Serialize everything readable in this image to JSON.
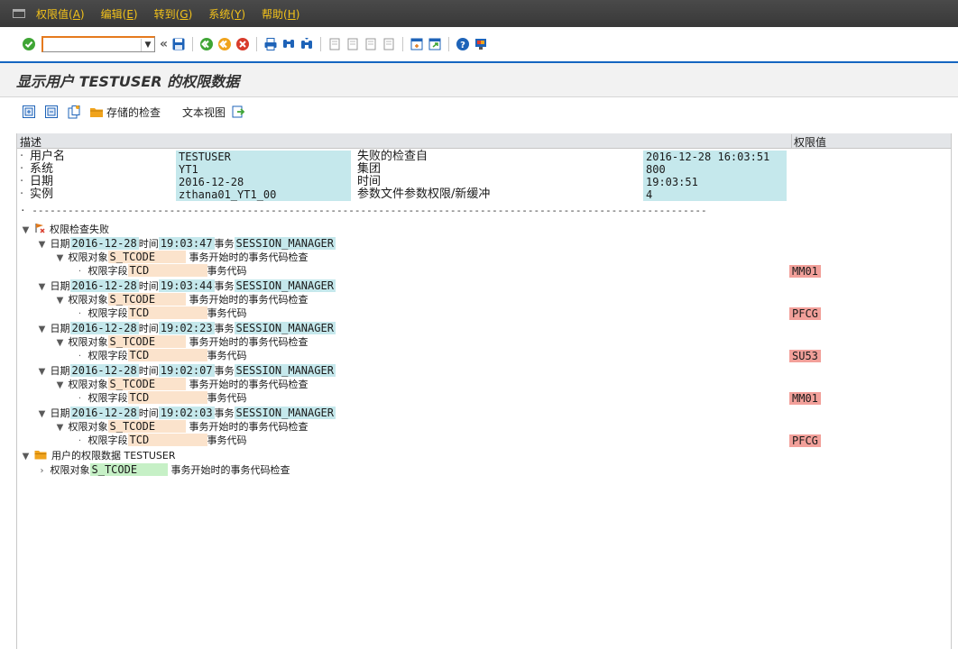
{
  "menu": {
    "items": [
      {
        "text": "权限值",
        "key": "A"
      },
      {
        "text": "编辑",
        "key": "E"
      },
      {
        "text": "转到",
        "key": "G"
      },
      {
        "text": "系统",
        "key": "Y"
      },
      {
        "text": "帮助",
        "key": "H"
      }
    ]
  },
  "toolbar": {
    "command_value": "",
    "icons": [
      "check-icon",
      "save-icon",
      "back-icon",
      "exit-icon",
      "cancel-icon",
      "print-icon",
      "find-icon",
      "find-next-icon",
      "first-page-icon",
      "prev-page-icon",
      "next-page-icon",
      "last-page-icon",
      "new-session-icon",
      "shortcut-icon",
      "help-icon",
      "customize-icon"
    ]
  },
  "title": "显示用户 TESTUSER 的权限数据",
  "app_toolbar": {
    "stored_checks_label": "存储的检查",
    "text_view_label": "文本视图"
  },
  "list": {
    "col_desc": "描述",
    "col_auth": "权限值",
    "header_rows": [
      {
        "label": "用户名",
        "value": "TESTUSER",
        "label2": "失败的检查自",
        "value2": "2016-12-28 16:03:51"
      },
      {
        "label": "系统",
        "value": "YT1",
        "label2": "集团",
        "value2": "800"
      },
      {
        "label": "日期",
        "value": "2016-12-28",
        "label2": "时间",
        "value2": "19:03:51"
      },
      {
        "label": "实例",
        "value": "zthana01_YT1_00",
        "label2": "参数文件参数权限/新缓冲",
        "value2": "4"
      }
    ],
    "dashes": "-----------------------------------------------------------------------------------------------------------------------------------------------------------------------",
    "failed_title": "权限检查失败",
    "lbl_date": "日期",
    "lbl_time": "时间",
    "lbl_tx": "事务",
    "lbl_obj": "权限对象",
    "lbl_field": "权限字段",
    "obj_name": "S_TCODE",
    "obj_desc": "事务开始时的事务代码检查",
    "field_name": "TCD",
    "field_desc": "事务代码",
    "failed_checks": [
      {
        "date": "2016-12-28",
        "time": "19:03:47",
        "tx": "SESSION_MANAGER",
        "value": "MM01"
      },
      {
        "date": "2016-12-28",
        "time": "19:03:44",
        "tx": "SESSION_MANAGER",
        "value": "PFCG"
      },
      {
        "date": "2016-12-28",
        "time": "19:02:23",
        "tx": "SESSION_MANAGER",
        "value": "SU53"
      },
      {
        "date": "2016-12-28",
        "time": "19:02:07",
        "tx": "SESSION_MANAGER",
        "value": "MM01"
      },
      {
        "date": "2016-12-28",
        "time": "19:02:03",
        "tx": "SESSION_MANAGER",
        "value": "PFCG"
      }
    ],
    "user_data_title": "用户的权限数据 TESTUSER",
    "user_obj_name": "S_TCODE",
    "user_obj_desc": "事务开始时的事务代码检查"
  }
}
